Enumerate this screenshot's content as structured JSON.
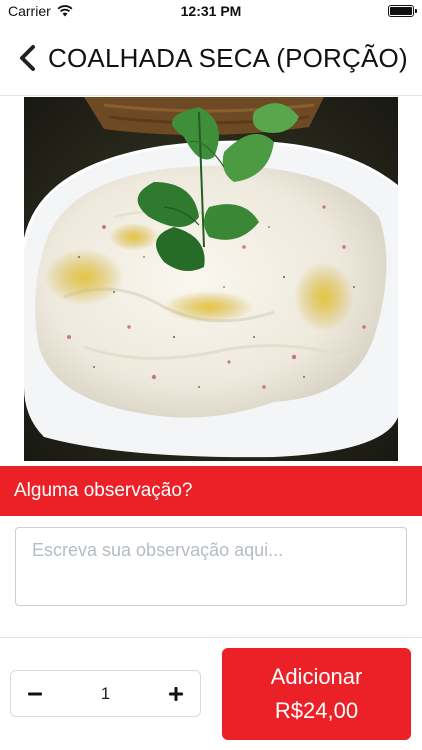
{
  "status_bar": {
    "carrier": "Carrier",
    "time": "12:31 PM",
    "wifi_icon": "wifi-icon",
    "battery_icon": "battery-icon"
  },
  "nav": {
    "title": "COALHADA SECA (PORÇÃO)",
    "back_icon": "chevron-left-icon"
  },
  "product": {
    "photo": "coalhada-seca-photo"
  },
  "observation": {
    "section_title": "Alguma observação?",
    "value": "",
    "placeholder": "Escreva sua observação aqui..."
  },
  "order": {
    "quantity": "1",
    "minus_icon": "minus-icon",
    "plus_icon": "plus-icon",
    "add_label": "Adicionar",
    "price": "R$24,00"
  },
  "colors": {
    "accent": "#ec2027",
    "placeholder": "#b6bcc4",
    "border": "#cfcfcf"
  }
}
